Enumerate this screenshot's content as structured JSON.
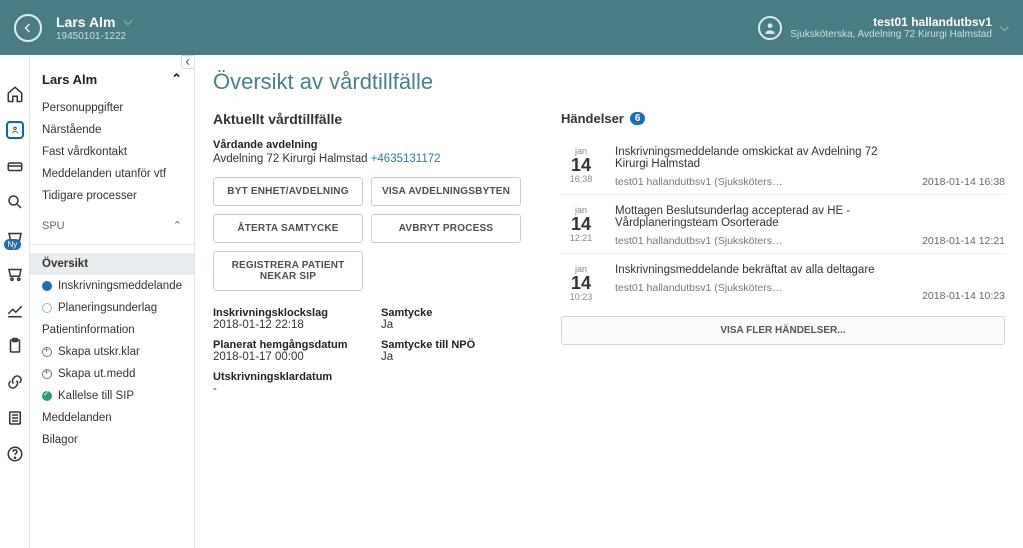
{
  "header": {
    "patient_name": "Lars Alm",
    "patient_id": "19450101-1222",
    "user_name": "test01 hallandutbsv1",
    "user_role": "Sjuksköterska, Avdelning 72 Kirurgi Halmstad"
  },
  "sidebar": {
    "patient_name": "Lars Alm",
    "items1": [
      "Personuppgifter",
      "Närstående",
      "Fast vårdkontakt",
      "Meddelanden utanför vtf",
      "Tidigare processer"
    ],
    "spu_label": "SPU",
    "items2": [
      "Översikt",
      "Inskrivningsmeddelande",
      "Planeringsunderlag",
      "Patientinformation",
      "Skapa utskr.klar",
      "Skapa ut.medd",
      "Kallelse till SIP",
      "Meddelanden",
      "Bilagor"
    ],
    "ny_badge": "Ny"
  },
  "main": {
    "title": "Översikt av vårdtillfälle",
    "section_title": "Aktuellt vårdtillfälle",
    "dept_label": "Vårdande avdelning",
    "dept_value": "Avdelning 72 Kirurgi Halmstad",
    "dept_phone": "+4635131172",
    "buttons": {
      "b1": "BYT ENHET/AVDELNING",
      "b2": "VISA AVDELNINGSBYTEN",
      "b3": "ÅTERTA SAMTYCKE",
      "b4": "AVBRYT PROCESS",
      "b5": "REGISTRERA PATIENT NEKAR SIP"
    },
    "info": {
      "l1": "Inskrivningsklockslag",
      "v1": "2018-01-12 22:18",
      "l2": "Samtycke",
      "v2": "Ja",
      "l3": "Planerat hemgångsdatum",
      "v3": "2018-01-17 00:00",
      "l4": "Samtycke till NPÖ",
      "v4": "Ja",
      "l5": "Utskrivningsklardatum",
      "v5": "-"
    }
  },
  "events": {
    "label": "Händelser",
    "count": "6",
    "list": [
      {
        "mon": "jan",
        "day": "14",
        "time": "16:38",
        "title": "Inskrivningsmeddelande omskickat av Avdelning 72 Kirurgi Halmstad",
        "by": "test01 hallandutbsv1 (Sjuksköters…",
        "ts": "2018-01-14 16:38"
      },
      {
        "mon": "jan",
        "day": "14",
        "time": "12:21",
        "title": "Mottagen Beslutsunderlag accepterad av HE - Vårdplaneringsteam Osorterade",
        "by": "test01 hallandutbsv1 (Sjuksköters…",
        "ts": "2018-01-14 12:21"
      },
      {
        "mon": "jan",
        "day": "14",
        "time": "10:23",
        "title": "Inskrivningsmeddelande bekräftat av alla deltagare",
        "by": "test01 hallandutbsv1 (Sjuksköters…",
        "ts": "2018-01-14 10:23"
      }
    ],
    "more_label": "VISA FLER HÄNDELSER..."
  }
}
